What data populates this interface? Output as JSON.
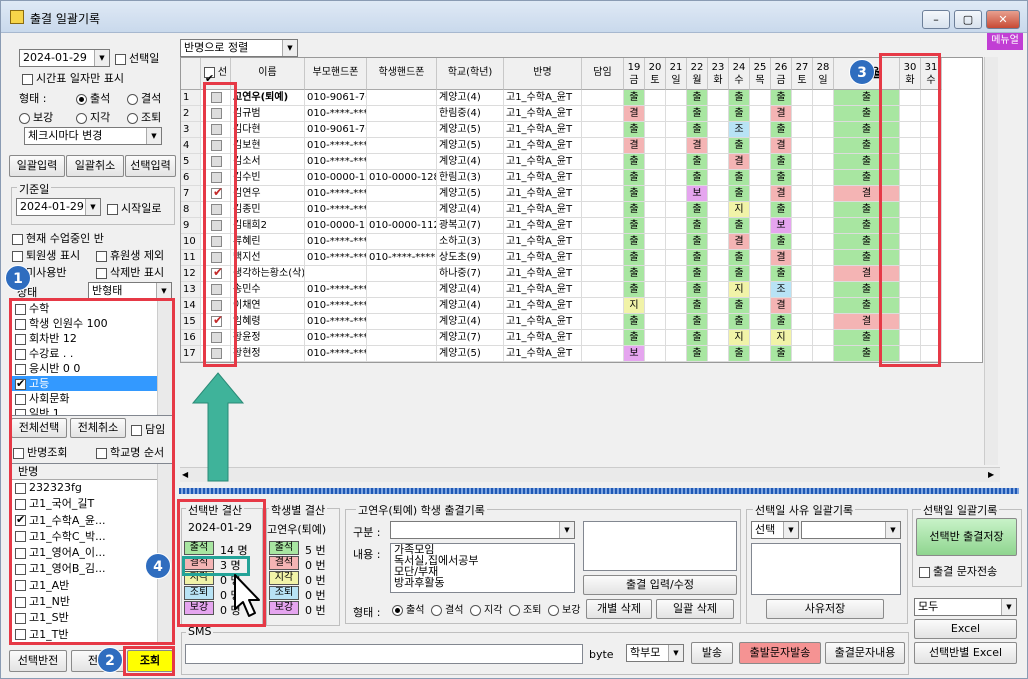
{
  "window": {
    "title": "출결 일괄기록",
    "menu_tab": "메뉴얼"
  },
  "left": {
    "date": "2024-01-29",
    "select_day_label": "선택일",
    "timetable_only_label": "시간표 일자만 표시",
    "form_label": "형태 :",
    "radios": [
      "출석",
      "결석",
      "보강",
      "지각",
      "조퇴"
    ],
    "checkmark_select": "체크시마다 변경",
    "tabs": [
      "일괄입력",
      "일괄취소",
      "선택입력"
    ],
    "base_date_label": "기준일",
    "base_date": "2024-01-29",
    "start_day_label": "시작일로",
    "options": [
      "현재 수업중인 반",
      "퇴원생 표시",
      "휴원생 제외",
      "미사용반",
      "삭제반 표시"
    ],
    "state_label": "상태",
    "state_select": "반형태",
    "class_types": [
      {
        "label": "수학",
        "checked": false
      },
      {
        "label": "학생 인원수 100",
        "checked": false
      },
      {
        "label": "회차반 12",
        "checked": false
      },
      {
        "label": "수강료 . .",
        "checked": false
      },
      {
        "label": "응시반 0 0",
        "checked": false
      },
      {
        "label": "고등",
        "checked": true
      },
      {
        "label": "사회문화",
        "checked": false
      },
      {
        "label": "일반 1",
        "checked": false
      }
    ],
    "select_all": "전체선택",
    "deselect_all": "전체취소",
    "teacher_label": "담임",
    "class_view_label": "반명조회",
    "school_order_label": "학교명 순서",
    "class_header": "반명",
    "classes": [
      {
        "label": "232323fg",
        "checked": false
      },
      {
        "label": "고1_국어_길T",
        "checked": false
      },
      {
        "label": "고1_수학A_윤...",
        "checked": true
      },
      {
        "label": "고1_수학C_박...",
        "checked": false
      },
      {
        "label": "고1_영어A_이...",
        "checked": false
      },
      {
        "label": "고1_영어B_김...",
        "checked": false
      },
      {
        "label": "고1_A반",
        "checked": false
      },
      {
        "label": "고1_N반",
        "checked": false
      },
      {
        "label": "고1_S반",
        "checked": false
      },
      {
        "label": "고1_T반",
        "checked": false
      }
    ],
    "invert_selection": "선택반전",
    "all_btn": "전체",
    "search_btn": "조회"
  },
  "grid": {
    "sort_select": "반명으로 정렬",
    "headers": {
      "select": "선택",
      "name": "이름",
      "parent_phone": "부모핸드폰",
      "student_phone": "학생핸드폰",
      "school": "학교(학년)",
      "class": "반명",
      "teacher": "담임"
    },
    "days": [
      {
        "d": "19",
        "w": "금"
      },
      {
        "d": "20",
        "w": "토"
      },
      {
        "d": "21",
        "w": "일"
      },
      {
        "d": "22",
        "w": "월"
      },
      {
        "d": "23",
        "w": "화"
      },
      {
        "d": "24",
        "w": "수"
      },
      {
        "d": "25",
        "w": "목"
      },
      {
        "d": "26",
        "w": "금"
      },
      {
        "d": "27",
        "w": "토"
      },
      {
        "d": "28",
        "w": "일"
      },
      {
        "d": "29",
        "w": "월"
      },
      {
        "d": "30",
        "w": "화"
      },
      {
        "d": "31",
        "w": "수"
      }
    ],
    "rows": [
      {
        "n": "1",
        "chk": false,
        "name": "고연우(퇴예)",
        "pp": "010-9061-768",
        "sp": "",
        "school": "계양고(4)",
        "cls": "고1_수학A_윤T",
        "att": [
          "출",
          "",
          "",
          "출",
          "",
          "출",
          "",
          "출",
          "",
          "",
          "출",
          "",
          ""
        ]
      },
      {
        "n": "2",
        "chk": false,
        "name": "김규범",
        "pp": "010-****-****",
        "sp": "",
        "school": "한림중(4)",
        "cls": "고1_수학A_윤T",
        "att": [
          "결",
          "",
          "",
          "출",
          "",
          "출",
          "",
          "결",
          "",
          "",
          "출",
          "",
          ""
        ]
      },
      {
        "n": "3",
        "chk": false,
        "name": "김다현",
        "pp": "010-9061-768",
        "sp": "",
        "school": "계양고(5)",
        "cls": "고1_수학A_윤T",
        "att": [
          "출",
          "",
          "",
          "출",
          "",
          "조",
          "",
          "출",
          "",
          "",
          "출",
          "",
          ""
        ]
      },
      {
        "n": "4",
        "chk": false,
        "name": "김보현",
        "pp": "010-****-****",
        "sp": "",
        "school": "계양고(5)",
        "cls": "고1_수학A_윤T",
        "att": [
          "결",
          "",
          "",
          "결",
          "",
          "출",
          "",
          "결",
          "",
          "",
          "출",
          "",
          ""
        ]
      },
      {
        "n": "5",
        "chk": false,
        "name": "김소서",
        "pp": "010-****-****",
        "sp": "",
        "school": "계양고(4)",
        "cls": "고1_수학A_윤T",
        "att": [
          "출",
          "",
          "",
          "출",
          "",
          "결",
          "",
          "출",
          "",
          "",
          "출",
          "",
          ""
        ]
      },
      {
        "n": "6",
        "chk": false,
        "name": "김수빈",
        "pp": "010-0000-128",
        "sp": "010-0000-1289",
        "school": "한림고(3)",
        "cls": "고1_수학A_윤T",
        "att": [
          "출",
          "",
          "",
          "출",
          "",
          "출",
          "",
          "출",
          "",
          "",
          "출",
          "",
          ""
        ]
      },
      {
        "n": "7",
        "chk": true,
        "name": "김연우",
        "pp": "010-****-****",
        "sp": "",
        "school": "계양고(5)",
        "cls": "고1_수학A_윤T",
        "att": [
          "출",
          "",
          "",
          "보",
          "",
          "출",
          "",
          "결",
          "",
          "",
          "결",
          "",
          ""
        ]
      },
      {
        "n": "8",
        "chk": false,
        "name": "김종민",
        "pp": "010-****-****",
        "sp": "",
        "school": "계양고(4)",
        "cls": "고1_수학A_윤T",
        "att": [
          "출",
          "",
          "",
          "출",
          "",
          "지",
          "",
          "출",
          "",
          "",
          "출",
          "",
          ""
        ]
      },
      {
        "n": "9",
        "chk": false,
        "name": "김태희2",
        "pp": "010-0000-112",
        "sp": "010-0000-1129",
        "school": "광복고(7)",
        "cls": "고1_수학A_윤T",
        "att": [
          "출",
          "",
          "",
          "출",
          "",
          "출",
          "",
          "보",
          "",
          "",
          "출",
          "",
          ""
        ]
      },
      {
        "n": "10",
        "chk": false,
        "name": "류혜린",
        "pp": "010-****-****",
        "sp": "",
        "school": "소하고(3)",
        "cls": "고1_수학A_윤T",
        "att": [
          "출",
          "",
          "",
          "출",
          "",
          "결",
          "",
          "출",
          "",
          "",
          "출",
          "",
          ""
        ]
      },
      {
        "n": "11",
        "chk": false,
        "name": "백지선",
        "pp": "010-****-****",
        "sp": "010-****-****",
        "school": "상도초(9)",
        "cls": "고1_수학A_윤T",
        "att": [
          "출",
          "",
          "",
          "출",
          "",
          "출",
          "",
          "결",
          "",
          "",
          "출",
          "",
          ""
        ]
      },
      {
        "n": "12",
        "chk": true,
        "name": "생각하는황소(삭)",
        "pp": "",
        "sp": "",
        "school": "하나중(7)",
        "cls": "고1_수학A_윤T",
        "att": [
          "출",
          "",
          "",
          "출",
          "",
          "출",
          "",
          "출",
          "",
          "",
          "결",
          "",
          ""
        ]
      },
      {
        "n": "13",
        "chk": false,
        "name": "송민수",
        "pp": "010-****-****",
        "sp": "",
        "school": "계양고(4)",
        "cls": "고1_수학A_윤T",
        "att": [
          "출",
          "",
          "",
          "출",
          "",
          "지",
          "",
          "조",
          "",
          "",
          "출",
          "",
          ""
        ]
      },
      {
        "n": "14",
        "chk": false,
        "name": "이채연",
        "pp": "010-****-****",
        "sp": "",
        "school": "계양고(4)",
        "cls": "고1_수학A_윤T",
        "att": [
          "지",
          "",
          "",
          "출",
          "",
          "출",
          "",
          "결",
          "",
          "",
          "출",
          "",
          ""
        ]
      },
      {
        "n": "15",
        "chk": true,
        "name": "임혜령",
        "pp": "010-****-****",
        "sp": "",
        "school": "계양고(4)",
        "cls": "고1_수학A_윤T",
        "att": [
          "출",
          "",
          "",
          "출",
          "",
          "출",
          "",
          "출",
          "",
          "",
          "결",
          "",
          ""
        ]
      },
      {
        "n": "16",
        "chk": false,
        "name": "황윤정",
        "pp": "010-****-****",
        "sp": "",
        "school": "계양고(7)",
        "cls": "고1_수학A_윤T",
        "att": [
          "출",
          "",
          "",
          "출",
          "",
          "지",
          "",
          "지",
          "",
          "",
          "출",
          "",
          ""
        ]
      },
      {
        "n": "17",
        "chk": false,
        "name": "황현정",
        "pp": "010-****-****",
        "sp": "",
        "school": "계양고(5)",
        "cls": "고1_수학A_윤T",
        "att": [
          "보",
          "",
          "",
          "출",
          "",
          "출",
          "",
          "출",
          "",
          "",
          "출",
          "",
          ""
        ]
      }
    ]
  },
  "summary": {
    "title": "선택반 결산",
    "date": "2024-01-29",
    "items": [
      {
        "label": "출석",
        "val": "14 명"
      },
      {
        "label": "결석",
        "val": "3 명"
      },
      {
        "label": "지각",
        "val": "0 명"
      },
      {
        "label": "조퇴",
        "val": "0 명"
      },
      {
        "label": "보강",
        "val": "0 명"
      }
    ],
    "student_title": "학생별 결산",
    "student_name": "고연우(퇴예)",
    "student_items": [
      {
        "label": "출석",
        "val": "5 번"
      },
      {
        "label": "결석",
        "val": "0 번"
      },
      {
        "label": "지각",
        "val": "0 번"
      },
      {
        "label": "조퇴",
        "val": "0 번"
      },
      {
        "label": "보강",
        "val": "0 번"
      }
    ]
  },
  "record": {
    "title": "고연우(퇴예) 학생 출결기록",
    "type_label": "구분 :",
    "content_label": "내용 :",
    "content_lines": [
      "가족모임",
      "독서실,집에서공부",
      "모단/부재",
      "방과후활동"
    ],
    "input_btn": "출결 입력/수정",
    "delete_btn": "개별 삭제",
    "bulk_delete_btn": "일괄 삭제",
    "form_label": "형태 :",
    "radios": [
      "출석",
      "결석",
      "지각",
      "조퇴",
      "보강"
    ]
  },
  "reason": {
    "title": "선택일 사유 일괄기록",
    "select": "선택",
    "save_btn": "사유저장"
  },
  "bulk": {
    "title": "선택일 일괄기록",
    "save_btn": "선택반 출결저장",
    "sms_check": "출결 문자전송",
    "select": "모두",
    "excel_btn": "Excel",
    "class_excel_btn": "선택반별 Excel"
  },
  "sms": {
    "label": "SMS",
    "byte": "byte",
    "target": "학부모",
    "send_btn": "발송",
    "attend_send_btn": "출발문자발송",
    "content_btn": "출결문자내용"
  },
  "annotations": [
    "1",
    "2",
    "3",
    "4"
  ]
}
